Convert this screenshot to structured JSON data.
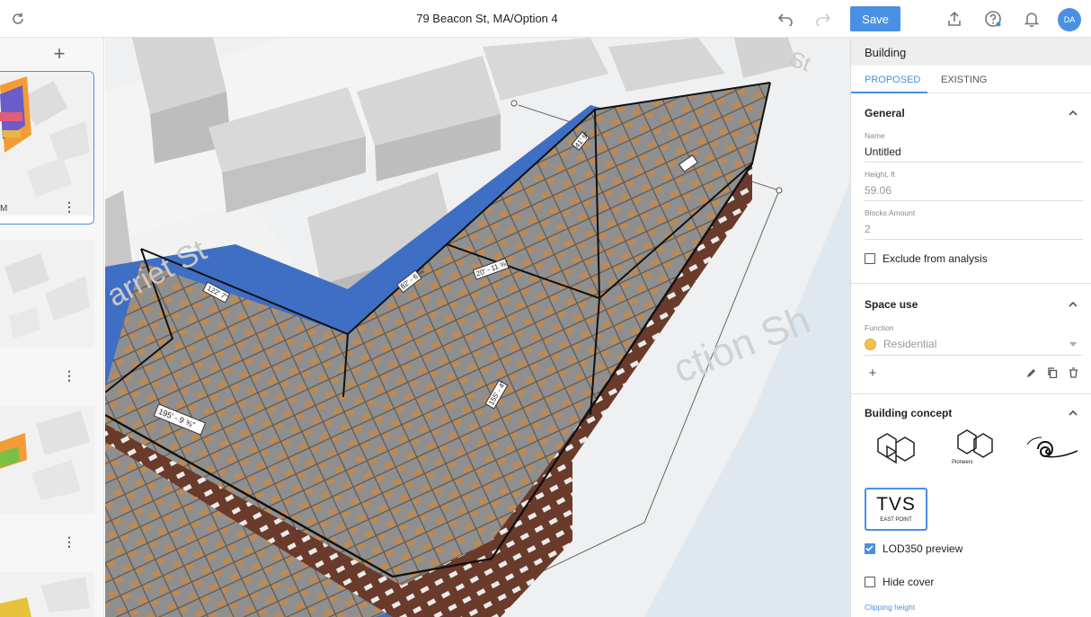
{
  "app": {
    "title": "79 Beacon St, MA/Option 4",
    "save_label": "Save",
    "avatar_initials": "DA",
    "accent": "#4a90e2"
  },
  "options": [
    {
      "label": "M",
      "active": true
    },
    {
      "label": "",
      "active": false
    },
    {
      "label": "",
      "active": false
    }
  ],
  "panel": {
    "header": "Building",
    "tabs": [
      "PROPOSED",
      "EXISTING"
    ],
    "general": {
      "title": "General",
      "name_label": "Name",
      "name_value": "Untitled",
      "height_label": "Height, ft",
      "height_value": "59.06",
      "blocks_label": "Blocks Amount",
      "blocks_value": "2",
      "exclude_label": "Exclude from analysis"
    },
    "space_use": {
      "title": "Space use",
      "function_label": "Function",
      "function_value": "Residential",
      "function_color": "#f2c14e"
    },
    "concept": {
      "title": "Building concept",
      "pioneers_label": "Pioneers",
      "tvs_logo": "TVS",
      "tvs_sub": "EAST POINT",
      "lod_label": "LOD350 preview",
      "lod_checked": true,
      "hide_cover_label": "Hide cover",
      "clipping_label": "Clipping height"
    }
  },
  "map": {
    "street_label_1": "arriet St",
    "street_label_2": "ction Sh",
    "street_label_3": "St",
    "dims": [
      "122' 7\"",
      "82' - 6 ⅝\"",
      "41' 9\"",
      "20' - 11 ⅝\"",
      "155' - 4\"",
      "195' - 9 ⅝\""
    ]
  }
}
